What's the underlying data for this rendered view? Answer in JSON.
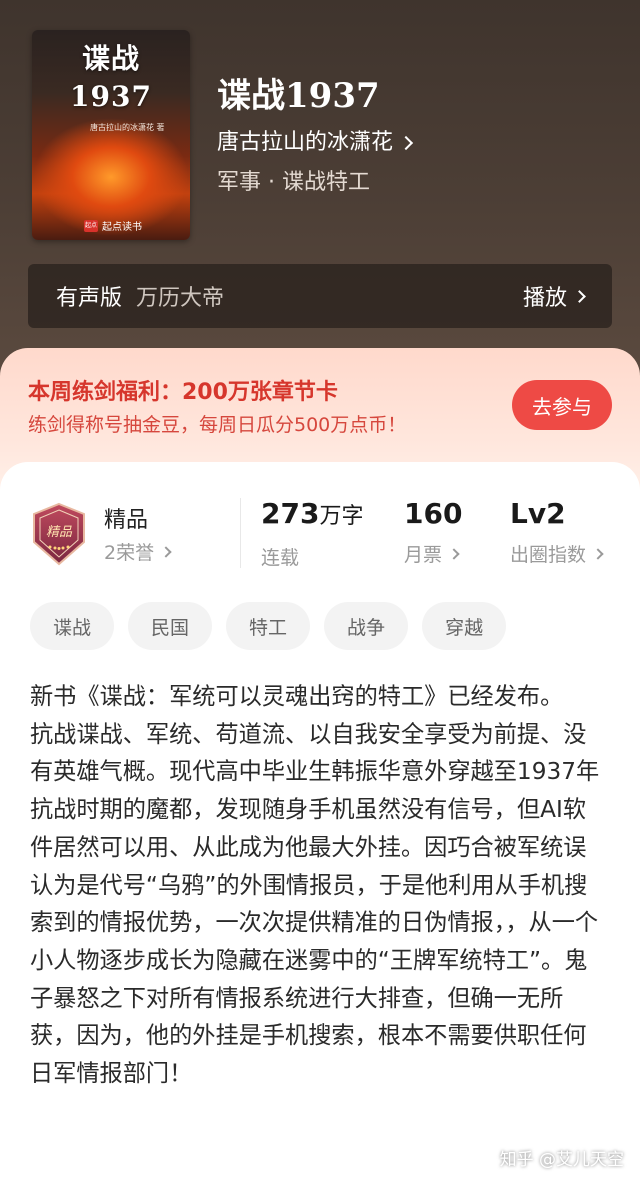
{
  "cover": {
    "title_line1": "谍战",
    "title_line2": "1937",
    "author_small": "唐古拉山的冰潇花 著",
    "publisher_logo": "起点",
    "publisher": "起点读书"
  },
  "book": {
    "title": "谍战1937",
    "author": "唐古拉山的冰潇花",
    "genre": "军事 · 谍战特工"
  },
  "audio": {
    "label": "有声版",
    "narrator": "万历大帝",
    "play_label": "播放"
  },
  "promo": {
    "title": "本周练剑福利：200万张章节卡",
    "subtitle": "练剑得称号抽金豆，每周日瓜分500万点币！",
    "button": "去参与"
  },
  "badge": {
    "name": "精品",
    "honor": "2荣誉",
    "icon_text": "精品"
  },
  "stats": [
    {
      "value": "273",
      "unit": "万字",
      "label": "连载"
    },
    {
      "value": "160",
      "unit": "",
      "label": "月票"
    },
    {
      "value": "Lv2",
      "unit": "",
      "label": "出圈指数"
    }
  ],
  "tags": [
    "谍战",
    "民国",
    "特工",
    "战争",
    "穿越"
  ],
  "description": [
    "新书《谍战：军统可以灵魂出窍的特工》已经发布。",
    "抗战谍战、军统、苟道流、以自我安全享受为前提、没有英雄气概。现代高中毕业生韩振华意外穿越至1937年抗战时期的魔都，发现随身手机虽然没有信号，但AI软件居然可以用、从此成为他最大外挂。因巧合被军统误认为是代号“乌鸦”的外围情报员，于是他利用从手机搜索到的情报优势，一次次提供精准的日伪情报，，从一个小人物逐步成长为隐藏在迷雾中的“王牌军统特工”。鬼子暴怒之下对所有情报系统进行大排查，但确一无所获，因为，他的外挂是手机搜索，根本不需要供职任何日军情报部门！"
  ],
  "watermark": "知乎 @艾儿天空",
  "colors": {
    "promo_accent": "#d6362c",
    "button_bg": "#ee4a45",
    "header_bg": "#4d3f36"
  }
}
